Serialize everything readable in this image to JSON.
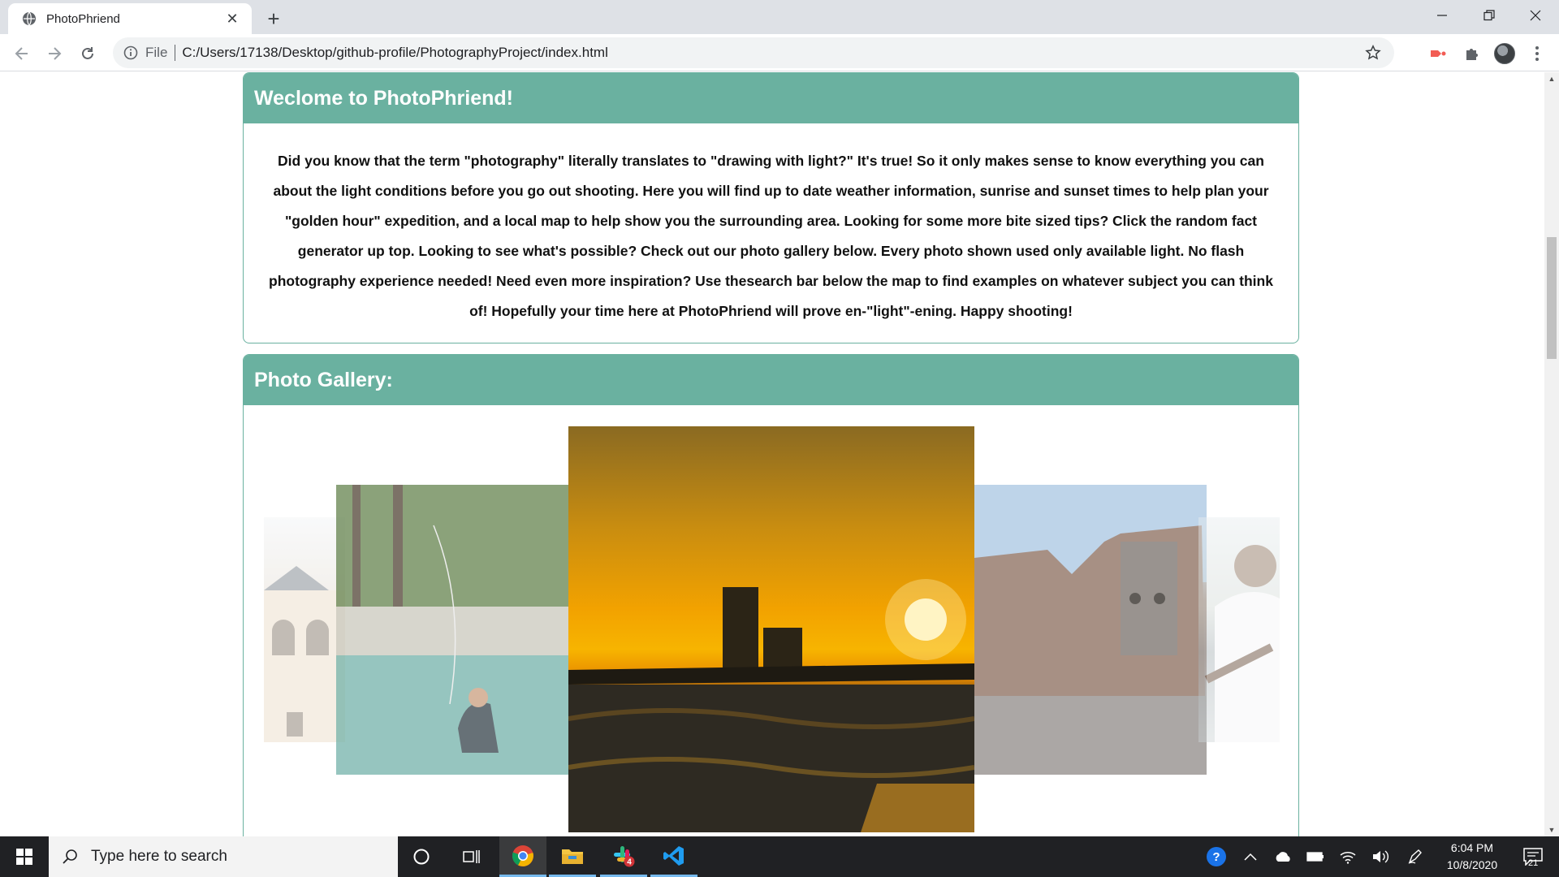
{
  "browser": {
    "tab_title": "PhotoPhriend",
    "scheme_label": "File",
    "url": "C:/Users/17138/Desktop/github-profile/PhotographyProject/index.html"
  },
  "page": {
    "welcome": {
      "title": "Weclome to PhotoPhriend!",
      "body": "Did you know that the term \"photography\" literally translates to \"drawing with light?\" It's true! So it only makes sense to know everything you can about the light conditions before you go out shooting. Here you will find up to date weather information, sunrise and sunset times to help plan your \"golden hour\" expedition, and a local map to help show you the surrounding area. Looking for some more bite sized tips? Click the random fact generator up top. Looking to see what's possible? Check out our photo gallery below. Every photo shown used only available light. No flash photography experience needed! Need even more inspiration? Use thesearch bar below the map to find examples on whatever subject you can think of! Hopefully your time here at PhotoPhriend will prove en-\"light\"-ening. Happy shooting!"
    },
    "gallery": {
      "title": "Photo Gallery:",
      "photos": [
        {
          "subject": "building-snow"
        },
        {
          "subject": "fly-fishing-river"
        },
        {
          "subject": "sunset-beach-skyline"
        },
        {
          "subject": "brick-ruins"
        },
        {
          "subject": "guitarist"
        }
      ]
    },
    "colors": {
      "accent": "#6ab1a0",
      "header_text": "#ffffff",
      "body_text": "#111111"
    }
  },
  "taskbar": {
    "search_placeholder": "Type here to search",
    "time": "6:04 PM",
    "date": "10/8/2020",
    "notification_count": "21",
    "slack_badge": "4"
  }
}
